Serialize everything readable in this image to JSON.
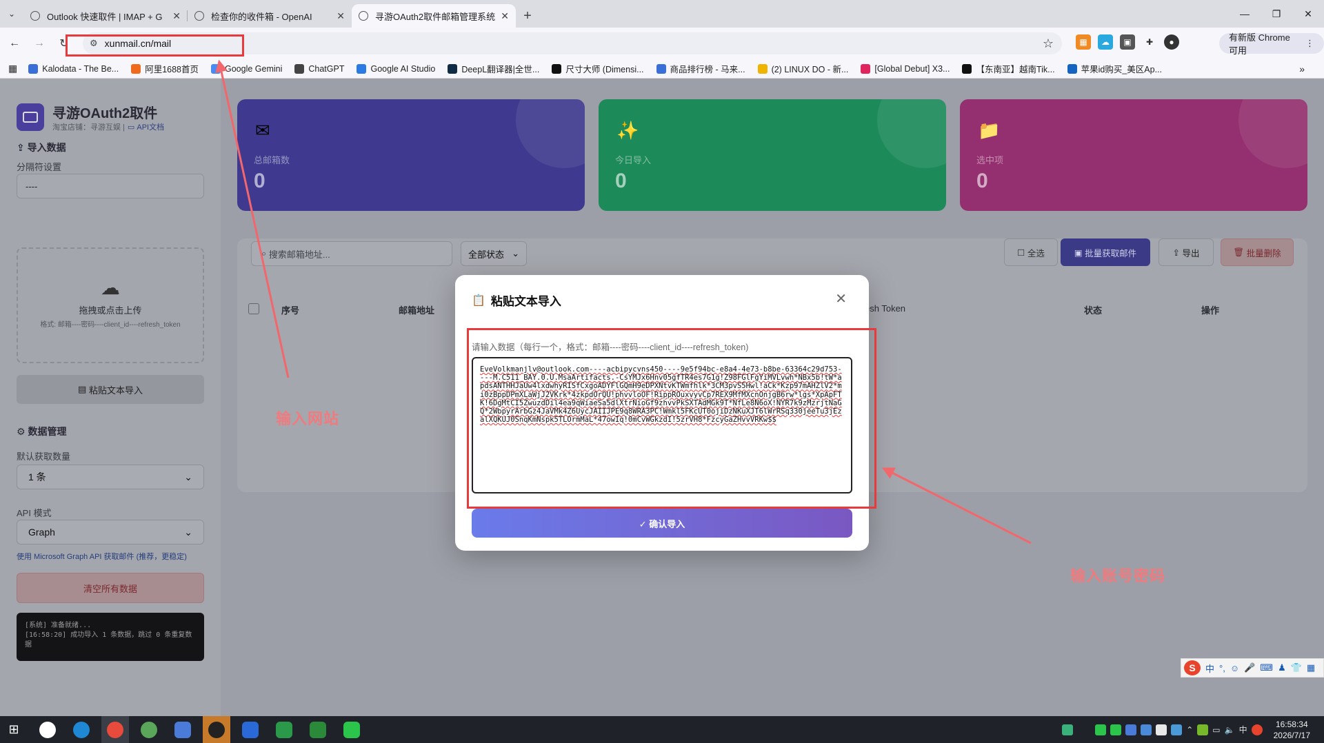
{
  "browser": {
    "tabs": [
      {
        "title": "Outlook 快速取件 | IMAP + G",
        "active": false
      },
      {
        "title": "检查你的收件箱 - OpenAI",
        "active": false
      },
      {
        "title": "寻游OAuth2取件邮箱管理系统",
        "active": true
      }
    ],
    "url": "xunmail.cn/mail",
    "new_version_label": "有新版 Chrome 可用",
    "bookmarks": [
      {
        "label": "Kalodata - The Be...",
        "color": "#3a6fd8"
      },
      {
        "label": "阿里1688首页",
        "color": "#f06a1d"
      },
      {
        "label": "Google Gemini",
        "color": "#4a8af4"
      },
      {
        "label": "ChatGPT",
        "color": "#444444"
      },
      {
        "label": "Google AI Studio",
        "color": "#2a7be4"
      },
      {
        "label": "DeepL翻译器|全世...",
        "color": "#0f2b46"
      },
      {
        "label": "尺寸大师 (Dimensi...",
        "color": "#111111"
      },
      {
        "label": "商品排行榜 - 马来...",
        "color": "#3a6fd8"
      },
      {
        "label": "(2) LINUX DO - 新...",
        "color": "#f0b400"
      },
      {
        "label": "[Global Debut] X3...",
        "color": "#e0245e"
      },
      {
        "label": "【东南亚】越南Tik...",
        "color": "#111111"
      },
      {
        "label": "苹果id购买_美区Ap...",
        "color": "#1565c0"
      }
    ]
  },
  "app": {
    "title": "寻游OAuth2取件",
    "subtitle": "淘宝店铺：寻游互娱 |",
    "api_doc": "API文档"
  },
  "sidebar": {
    "import_title": "导入数据",
    "separator_label": "分隔符设置",
    "separator_value": "----",
    "upload_text": "拖拽或点击上传",
    "upload_format": "格式: 邮箱----密码----client_id----refresh_token",
    "paste_button": "粘贴文本导入",
    "data_title": "数据管理",
    "default_count_label": "默认获取数量",
    "default_count_value": "1 条",
    "api_mode_label": "API 模式",
    "api_mode_value": "Graph",
    "api_tip": "使用 Microsoft Graph API 获取邮件 (推荐，更稳定)",
    "clear_button": "清空所有数据",
    "log_line1": "[系统] 准备就绪...",
    "log_line2": "[16:58:20] 成功导入 1 条数据，跳过 0 条重复数据"
  },
  "stats": [
    {
      "label": "总邮箱数",
      "value": "0",
      "icon": "email-icon"
    },
    {
      "label": "今日导入",
      "value": "0",
      "icon": "sparkles-icon"
    },
    {
      "label": "选中项",
      "value": "0",
      "icon": "folder-icon"
    }
  ],
  "toolbar": {
    "search_placeholder": "搜索邮箱地址...",
    "status_filter": "全部状态",
    "select_all": "全选",
    "batch_fetch": "批量获取邮件",
    "export": "导出",
    "batch_delete": "批量删除"
  },
  "table": {
    "headers": [
      "序号",
      "邮箱地址",
      "esh Token",
      "状态",
      "操作"
    ]
  },
  "modal": {
    "title": "粘贴文本导入",
    "hint": "请输入数据（每行一个，格式：邮箱----密码----client_id----refresh_token)",
    "textarea_value": "EveVolkmanjlv@outlook.com----acbipycvns450----9e5f94bc-e8a4-4e73-b8be-63364c29d753----M.C511_BAY.0.U.MsaArtifacts.-CsYMJx6Hnv05gfTR4es7G1g!Z98FGlFgYiMVLvwh*NBx5b!tW*apdsANTHHJaUw4lxdwhyRISfCxgoADYFlGQmH9eDPXNtvKTWmfhlk*3CM3pvS5Hwl!aCk*Kzp97mAHZlV2*mi0zBppDPmXLaWjJ2VKrk*4zkpdOrQU!phvvloOF!RippROuxvyvCp7REX9MfMXcnOnjgB6rw*lgs*XpApFTK!6DgMtCI5ZwuzdDil4ea9qWiaeSa5dlXtrNioGf9zhvvPkSXTAdMGk9T*NfLe8N6oX!NYR7k9zMzrjtNaGQ*2WbpyrArbGz4JaVMk4Z6UycJAIIJPE9q8WRA3PC!Wmkl5FKcUT0ojiDzNKuXJT6lWrRSq330jeeTu3jEzalXQKUJ0SnqKmNspk5TLOrmMaL*47owIq!0mCvWGkzdI!5zrVH8*FzcyGaZHvvVRKw$$",
    "confirm_button": "✓ 确认导入"
  },
  "annotations": {
    "url_note": "输入网站",
    "account_note": "输入账号密码"
  },
  "taskbar": {
    "time": "16:58:34",
    "date": "2026/7/17",
    "ime_lang": "中"
  },
  "colors": {
    "card1": "#3f3a8f",
    "card2": "#1d8a5a",
    "card3": "#94306f",
    "annotation": "#e8393c"
  }
}
